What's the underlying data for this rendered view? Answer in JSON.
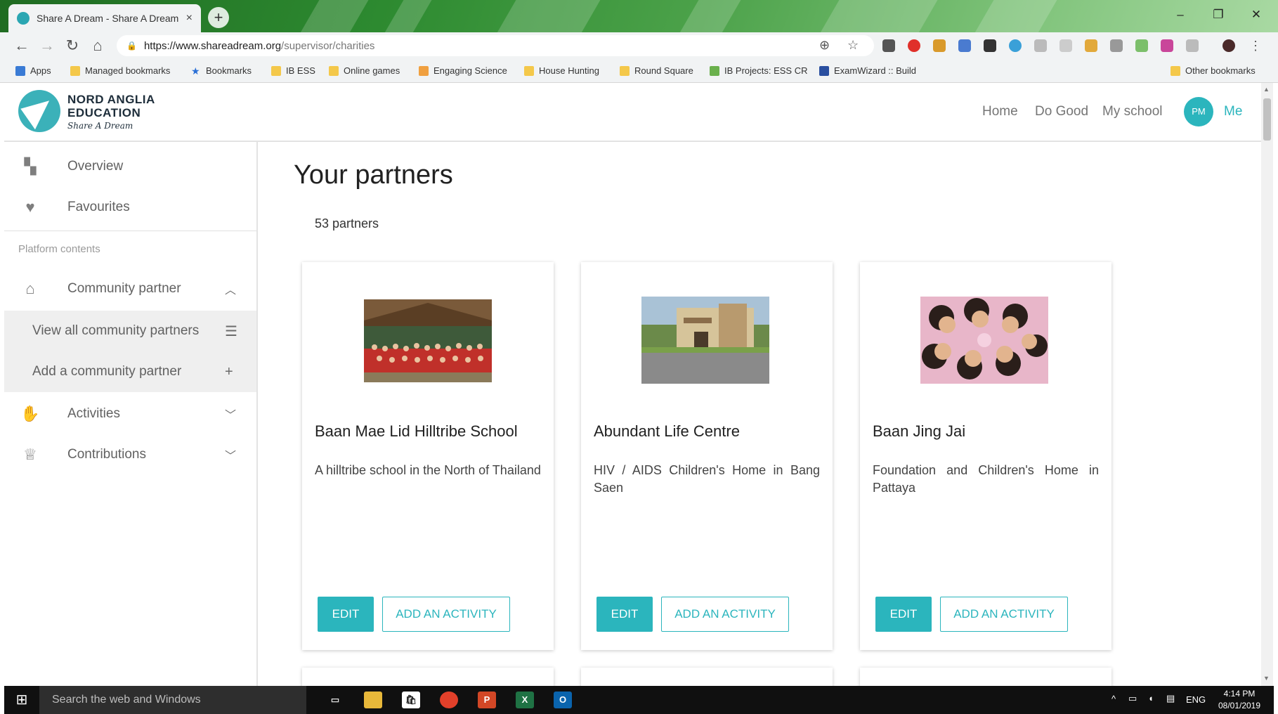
{
  "browser": {
    "tab_title": "Share A Dream - Share A Dream",
    "tab_close": "×",
    "new_tab": "+",
    "url_host": "https://www.shareadream.org",
    "url_path": "/supervisor/charities",
    "window_controls": [
      "–",
      "❐",
      "✕"
    ],
    "bookmarks": [
      {
        "label": "Apps",
        "icon": "apps-grid-icon"
      },
      {
        "label": "Managed bookmarks",
        "icon": "folder-icon"
      },
      {
        "label": "Bookmarks",
        "icon": "star-icon"
      },
      {
        "label": "IB ESS",
        "icon": "folder-icon"
      },
      {
        "label": "Online games",
        "icon": "folder-icon"
      },
      {
        "label": "Engaging Science",
        "icon": "site-icon"
      },
      {
        "label": "House Hunting",
        "icon": "folder-icon"
      },
      {
        "label": "Round Square",
        "icon": "folder-icon"
      },
      {
        "label": "IB Projects: ESS CR",
        "icon": "site-icon"
      },
      {
        "label": "ExamWizard :: Build",
        "icon": "site-icon"
      },
      {
        "label": "Other bookmarks",
        "icon": "folder-icon"
      }
    ]
  },
  "header": {
    "brand_line1": "NORD ANGLIA",
    "brand_line2": "EDUCATION",
    "brand_line3": "Share A Dream",
    "nav": [
      "Home",
      "Do Good",
      "My school"
    ],
    "avatar_initials": "PM",
    "me_label": "Me"
  },
  "sidebar": {
    "overview": "Overview",
    "favourites": "Favourites",
    "section_label": "Platform contents",
    "community_partner": "Community partner",
    "view_all": "View all community partners",
    "add_partner": "Add a community partner",
    "activities": "Activities",
    "contributions": "Contributions"
  },
  "main": {
    "title": "Your partners",
    "count": "53 partners",
    "cards": [
      {
        "name": "Baan Mae Lid Hilltribe School",
        "description": "A hilltribe school in the North of Thailand",
        "edit": "EDIT",
        "add_activity": "ADD AN ACTIVITY"
      },
      {
        "name": "Abundant Life Centre",
        "description": "HIV / AIDS Children's Home in Bang Saen",
        "edit": "EDIT",
        "add_activity": "ADD AN ACTIVITY"
      },
      {
        "name": "Baan Jing Jai",
        "description": "Foundation and Children's Home in Pattaya",
        "edit": "EDIT",
        "add_activity": "ADD AN ACTIVITY"
      }
    ]
  },
  "taskbar": {
    "search_placeholder": "Search the web and Windows",
    "language": "ENG",
    "time": "4:14 PM",
    "date": "08/01/2019"
  },
  "colors": {
    "accent": "#2bb5bd",
    "title_bar_green": "#2d8a30"
  }
}
